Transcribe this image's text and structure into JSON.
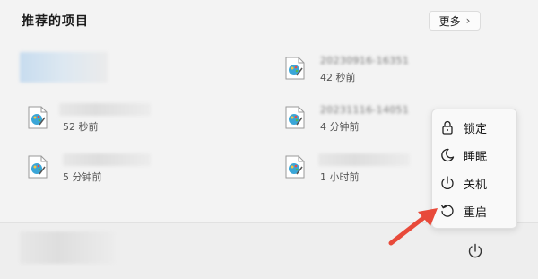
{
  "header": {
    "title": "推荐的项目",
    "more_label": "更多"
  },
  "items": [
    {
      "title": "20230916-163511",
      "time": "42 秒前"
    },
    {
      "title": "",
      "time": "52 秒前"
    },
    {
      "title": "20231116-14051",
      "time": "4 分钟前"
    },
    {
      "title": "",
      "time": "5 分钟前"
    },
    {
      "title": "",
      "time": "1 小时前"
    }
  ],
  "power_menu": {
    "items": [
      {
        "label": "锁定",
        "icon": "lock-icon"
      },
      {
        "label": "睡眠",
        "icon": "moon-icon"
      },
      {
        "label": "关机",
        "icon": "power-icon"
      },
      {
        "label": "重启",
        "icon": "restart-icon"
      }
    ]
  },
  "colors": {
    "background": "#f3f3f3",
    "menu_background": "#f9f9f9",
    "arrow": "#e84a3a"
  }
}
